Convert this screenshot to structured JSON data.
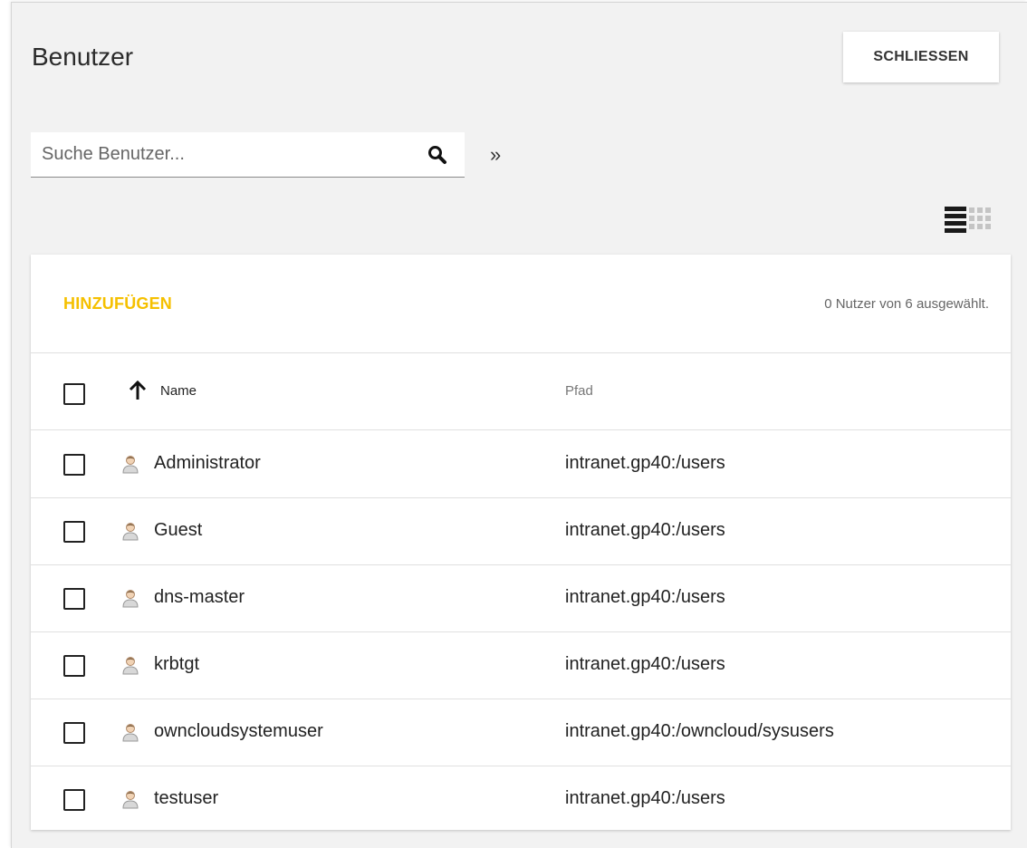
{
  "header": {
    "title": "Benutzer",
    "close_label": "SCHLIESSEN"
  },
  "search": {
    "placeholder": "Suche Benutzer...",
    "value": "",
    "search_icon": "search-icon",
    "expand_icon": "double-chevron-right-icon"
  },
  "view_toggle": {
    "list_icon": "list-view-icon",
    "grid_icon": "grid-view-icon",
    "active": "list"
  },
  "card": {
    "add_label": "HINZUFÜGEN",
    "selection_info": "0 Nutzer von 6 ausgewählt."
  },
  "table": {
    "columns": {
      "name": "Name",
      "path": "Pfad"
    },
    "sort": {
      "column": "name",
      "direction": "ascending",
      "icon": "arrow-up-icon"
    },
    "rows": [
      {
        "name": "Administrator",
        "path": "intranet.gp40:/users"
      },
      {
        "name": "Guest",
        "path": "intranet.gp40:/users"
      },
      {
        "name": "dns-master",
        "path": "intranet.gp40:/users"
      },
      {
        "name": "krbtgt",
        "path": "intranet.gp40:/users"
      },
      {
        "name": "owncloudsystemuser",
        "path": "intranet.gp40:/owncloud/sysusers"
      },
      {
        "name": "testuser",
        "path": "intranet.gp40:/users"
      }
    ]
  },
  "colors": {
    "accent": "#f5c000",
    "background": "#f2f2f2",
    "card": "#ffffff"
  }
}
